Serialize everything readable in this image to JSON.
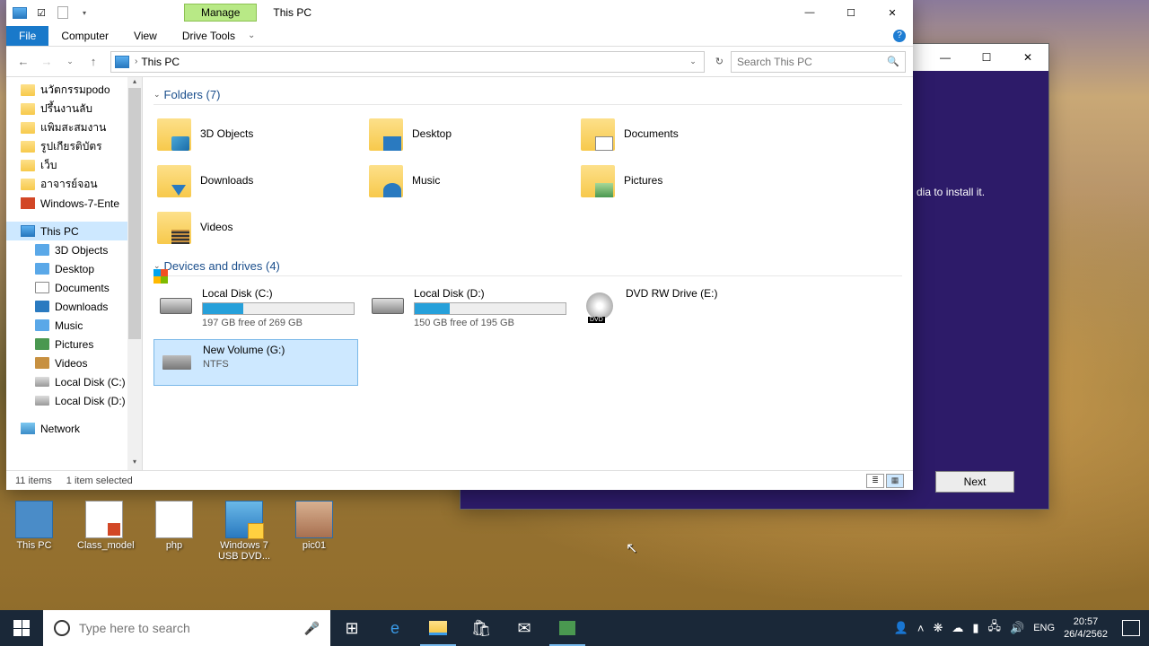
{
  "explorer": {
    "title": "This PC",
    "contextTab": "Manage",
    "contextGroup": "Drive Tools",
    "tabs": {
      "file": "File",
      "computer": "Computer",
      "view": "View"
    },
    "address": "This PC",
    "searchPlaceholder": "Search This PC",
    "nav": {
      "quick": [
        "นวัตกรรมpodo",
        "ปรึ้นงานลับ",
        "แพิมสะสมงาน",
        "รูปเกียรติบัตร",
        "เว็บ",
        "อาจารย์จอน",
        "Windows-7-Ente"
      ],
      "thispc": "This PC",
      "pcitems": [
        "3D Objects",
        "Desktop",
        "Documents",
        "Downloads",
        "Music",
        "Pictures",
        "Videos",
        "Local Disk (C:)",
        "Local Disk (D:)"
      ],
      "network": "Network"
    },
    "sections": {
      "folders": "Folders (7)",
      "drives": "Devices and drives (4)"
    },
    "folders": [
      "3D Objects",
      "Desktop",
      "Documents",
      "Downloads",
      "Music",
      "Pictures",
      "Videos"
    ],
    "drives": [
      {
        "name": "Local Disk (C:)",
        "free": "197 GB free of 269 GB",
        "pct": 27
      },
      {
        "name": "Local Disk (D:)",
        "free": "150 GB free of 195 GB",
        "pct": 23
      },
      {
        "name": "DVD RW Drive (E:)",
        "type": "dvd"
      },
      {
        "name": "New Volume (G:)",
        "sub": "NTFS",
        "type": "usb",
        "selected": true
      }
    ],
    "status": {
      "items": "11 items",
      "selected": "1 item selected"
    }
  },
  "installer": {
    "partial": "dia to install it.",
    "next": "Next"
  },
  "desktop": {
    "icons": [
      "This PC",
      "Class_model",
      "php",
      "Windows 7 USB DVD...",
      "pic01"
    ]
  },
  "taskbar": {
    "searchPlaceholder": "Type here to search",
    "lang": "ENG",
    "time": "20:57",
    "date": "26/4/2562"
  }
}
